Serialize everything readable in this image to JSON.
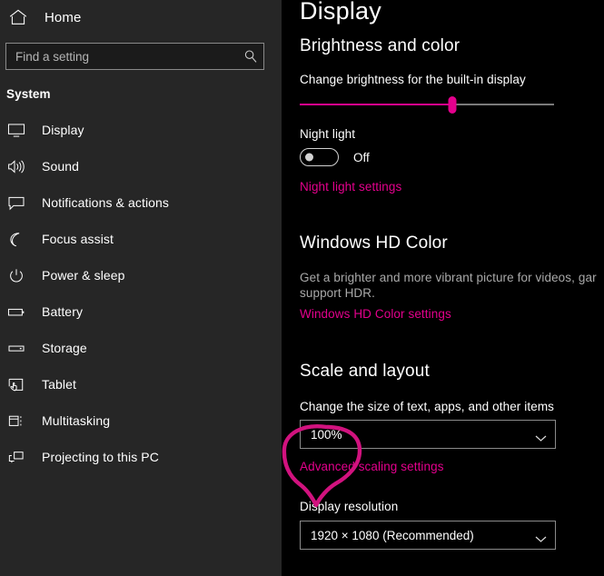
{
  "colors": {
    "accent": "#e3008c",
    "sidebar_bg": "#262626",
    "main_bg": "#000000",
    "annotation": "#d1127e"
  },
  "sidebar": {
    "home": {
      "label": "Home",
      "icon": "home-icon"
    },
    "search": {
      "placeholder": "Find a setting",
      "value": "",
      "icon": "search-icon"
    },
    "section_label": "System",
    "items": [
      {
        "label": "Display",
        "icon": "monitor-icon",
        "selected": true
      },
      {
        "label": "Sound",
        "icon": "speaker-icon",
        "selected": false
      },
      {
        "label": "Notifications & actions",
        "icon": "chat-bubble-icon",
        "selected": false
      },
      {
        "label": "Focus assist",
        "icon": "moon-icon",
        "selected": false
      },
      {
        "label": "Power & sleep",
        "icon": "power-icon",
        "selected": false
      },
      {
        "label": "Battery",
        "icon": "battery-icon",
        "selected": false
      },
      {
        "label": "Storage",
        "icon": "drive-icon",
        "selected": false
      },
      {
        "label": "Tablet",
        "icon": "tablet-hand-icon",
        "selected": false
      },
      {
        "label": "Multitasking",
        "icon": "multitasking-icon",
        "selected": false
      },
      {
        "label": "Projecting to this PC",
        "icon": "projecting-icon",
        "selected": false
      }
    ]
  },
  "main": {
    "page_title": "Display",
    "brightness": {
      "group_title": "Brightness and color",
      "slider_label": "Change brightness for the built-in display",
      "slider_percent": 60
    },
    "night_light": {
      "label": "Night light",
      "toggle_state": "Off",
      "toggle_on": false,
      "link": "Night light settings"
    },
    "hd_color": {
      "group_title": "Windows HD Color",
      "description_line1": "Get a brighter and more vibrant picture for videos, gar",
      "description_line2": "support HDR.",
      "link": "Windows HD Color settings"
    },
    "scale": {
      "group_title": "Scale and layout",
      "scale_label": "Change the size of text, apps, and other items",
      "scale_value": "100%",
      "link": "Advanced scaling settings"
    },
    "resolution": {
      "label": "Display resolution",
      "value": "1920 × 1080 (Recommended)"
    }
  }
}
